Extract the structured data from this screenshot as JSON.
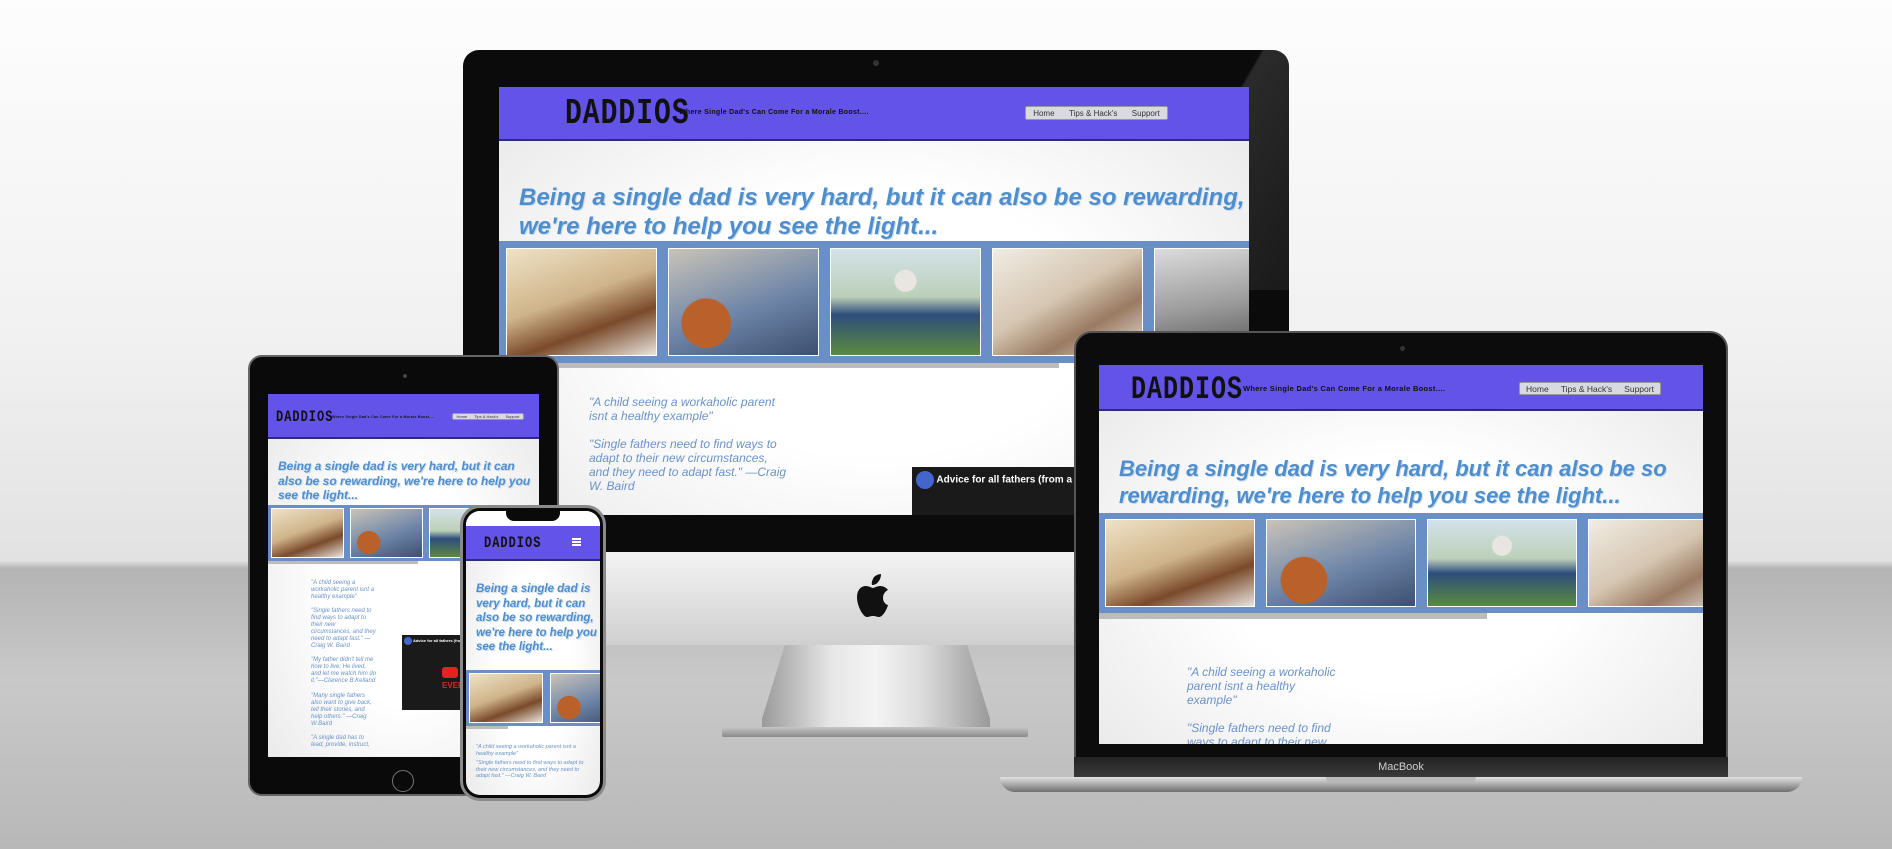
{
  "site": {
    "logo": "DADDIOS",
    "tagline": "Where Single Dad's Can Come For a Morale Boost....",
    "nav": [
      "Home",
      "Tips & Hack's",
      "Support"
    ],
    "hero": "Being a single dad is very hard, but it can also be so rewarding, we're here to help you see the light...",
    "quotes": [
      "\"A child seeing a workaholic parent isnt a healthy example\"",
      "\"Single fathers need to find ways to adapt to their new circumstances, and they need to adapt fast.\" —Craig W. Baird",
      "\"My father didn't tell me how to live; He lived, and let me watch him do it.\"—Clarence B.Kelland",
      "\"Many single fathers also want to give back, tell their stories, and help others.\" —Craig W.Baird",
      "\"A single dad has to lead, provide, instruct,"
    ],
    "video_title": "Advice for all fathers (from a single dad)",
    "video_badge": "EVERY",
    "phone_menu_icon": "hamburger-icon",
    "photo_subjects": [
      "dad-lifting-child",
      "boy-with-basketball",
      "child-on-shoulders",
      "dad-and-child-playing",
      "dad-and-daughter"
    ]
  },
  "devices": {
    "laptop_label": "MacBook",
    "desktop_logo_icon": "apple-icon"
  },
  "colors": {
    "nav": "#6353e8",
    "hero_text": "#4f8ecc",
    "photo_strip": "#6a8fc7",
    "quote_text": "#6b93c9"
  }
}
